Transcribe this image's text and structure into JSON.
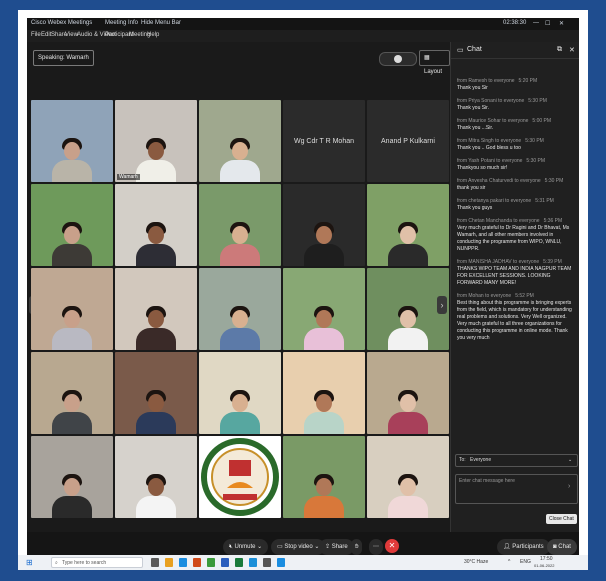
{
  "window": {
    "app_title": "Cisco Webex Meetings",
    "meeting_info": "Meeting Info",
    "hide_menu_bar": "Hide Menu Bar",
    "time": "02:38:30"
  },
  "menu": [
    "File",
    "Edit",
    "Share",
    "View",
    "Audio & Video",
    "Participant",
    "Meeting",
    "Help"
  ],
  "toolbar": {
    "speaking": "Speaking: Wamarh",
    "layout": "Layout"
  },
  "participants": [
    {
      "name": "",
      "bg": "#8fa3b8",
      "shirt": "#b9b4a8"
    },
    {
      "name": "Wamarh",
      "bg": "#c8c2bc",
      "shirt": "#f0efe8"
    },
    {
      "name": "",
      "bg": "#9fa88e",
      "shirt": "#e4e8ec"
    },
    {
      "name": "Wg Cdr T R Mohan",
      "bg": "",
      "shirt": ""
    },
    {
      "name": "Anand P Kulkarni",
      "bg": "",
      "shirt": ""
    },
    {
      "name": "",
      "bg": "#6e9a5b",
      "shirt": "#3d3a36"
    },
    {
      "name": "",
      "bg": "#d3cfc8",
      "shirt": "#2d2d35"
    },
    {
      "name": "",
      "bg": "#7a9a6a",
      "shirt": "#cc7a7a"
    },
    {
      "name": "",
      "bg": "#2a2a2a",
      "shirt": "#1e1e1e"
    },
    {
      "name": "",
      "bg": "#7fa066",
      "shirt": "#2a2a2a"
    },
    {
      "name": "",
      "bg": "#bfa893",
      "shirt": "#b9b9c2"
    },
    {
      "name": "",
      "bg": "#d2c8bd",
      "shirt": "#3a2a28"
    },
    {
      "name": "",
      "bg": "#9aa89c",
      "shirt": "#5c7aa8"
    },
    {
      "name": "",
      "bg": "#88a874",
      "shirt": "#e8c0d8"
    },
    {
      "name": "",
      "bg": "#6f8f5f",
      "shirt": "#f2f2f2"
    },
    {
      "name": "",
      "bg": "#b8a890",
      "shirt": "#404448"
    },
    {
      "name": "",
      "bg": "#7a5a4a",
      "shirt": "#2b3a5a"
    },
    {
      "name": "",
      "bg": "#e0d8c4",
      "shirt": "#57a7a0"
    },
    {
      "name": "",
      "bg": "#e8cfae",
      "shirt": "#b8d4c8"
    },
    {
      "name": "",
      "bg": "#b9a98f",
      "shirt": "#a8405a"
    },
    {
      "name": "",
      "bg": "#a8a39c",
      "shirt": "#2a2a2a"
    },
    {
      "name": "",
      "bg": "#d6d2cc",
      "shirt": "#f4f4f4"
    },
    {
      "name": "logo",
      "bg": "",
      "shirt": ""
    },
    {
      "name": "",
      "bg": "#7a9a66",
      "shirt": "#d8783a"
    },
    {
      "name": "",
      "bg": "#d8cfc0",
      "shirt": "#f0d8d8"
    }
  ],
  "chat": {
    "title": "Chat",
    "messages": [
      {
        "from": "from Ramesh to everyone",
        "time": "5:20 PM",
        "text": "Thank you Sir"
      },
      {
        "from": "from Priya Sonani to everyone",
        "time": "5:30 PM",
        "text": "Thank you Sir."
      },
      {
        "from": "from Maurice Sohar to everyone",
        "time": "5:00 PM",
        "text": "Thank you ...Sir."
      },
      {
        "from": "from Mitra Singh to everyone",
        "time": "5:30 PM",
        "text": "Thank you .. God bless u too"
      },
      {
        "from": "from Yash Potani to everyone",
        "time": "5:30 PM",
        "text": "Thankyou so much sir!"
      },
      {
        "from": "from Anvesha Chaturvedi to everyone",
        "time": "5:30 PM",
        "text": "thank you sir"
      },
      {
        "from": "from chetanya pakari to everyone",
        "time": "5:31 PM",
        "text": "Thank you guys"
      },
      {
        "from": "from Chetan Manchanda to everyone",
        "time": "5:36 PM",
        "text": "Very much grateful to Dr Ragini and Dr Bhavat, Ms Wamarh, and all other members involved in conducting the programme from WIPO, WNLU, NUNPPR."
      },
      {
        "from": "from MANISHA JADHAV to everyone",
        "time": "5:39 PM",
        "text": "THANKS WIPO TEAM AND INDIA NAGPUR TEAM FOR EXCELLENT SESSIONS. LOOKING FORWARD MANY MORE!"
      },
      {
        "from": "from Mohan to everyone",
        "time": "5:52 PM",
        "text": "Best thing about this programme is bringing experts from the field, which is mandatory for understanding real problems and solutions. Very Well organized. Very much grateful to all three organizations for conducting this programme in online mode. Thank you very much"
      }
    ],
    "to_label": "To:",
    "to_value": "Everyone",
    "placeholder": "Enter chat message here"
  },
  "controls": {
    "unmute": "Unmute",
    "stop_video": "Stop video",
    "share": "Share",
    "participants": "Participants",
    "chat": "Chat",
    "close_chat_tooltip": "Close Chat"
  },
  "taskbar": {
    "search": "Type here to search",
    "weather": "30°C Haze",
    "lang": "ENG",
    "clock_time": "17:50",
    "clock_date": "01-06-2022"
  },
  "colors": {
    "accent": "#1f4d8f",
    "end_call": "#e03a3a"
  }
}
